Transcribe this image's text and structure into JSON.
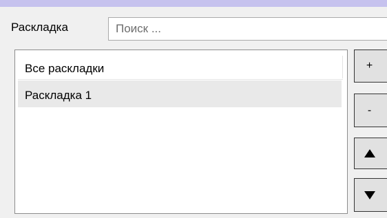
{
  "form": {
    "label": "Раскладка",
    "search_placeholder": "Поиск ..."
  },
  "list": {
    "header": "Все раскладки",
    "items": [
      {
        "label": "Раскладка 1",
        "selected": true
      }
    ]
  },
  "buttons": {
    "add_label": "+",
    "remove_label": "-",
    "move_up_icon": "triangle-up",
    "move_down_icon": "triangle-down"
  },
  "colors": {
    "top_stripe": "#c6c2ee",
    "panel_background": "#f0f0f0",
    "selected_row": "#e9e9e9"
  }
}
